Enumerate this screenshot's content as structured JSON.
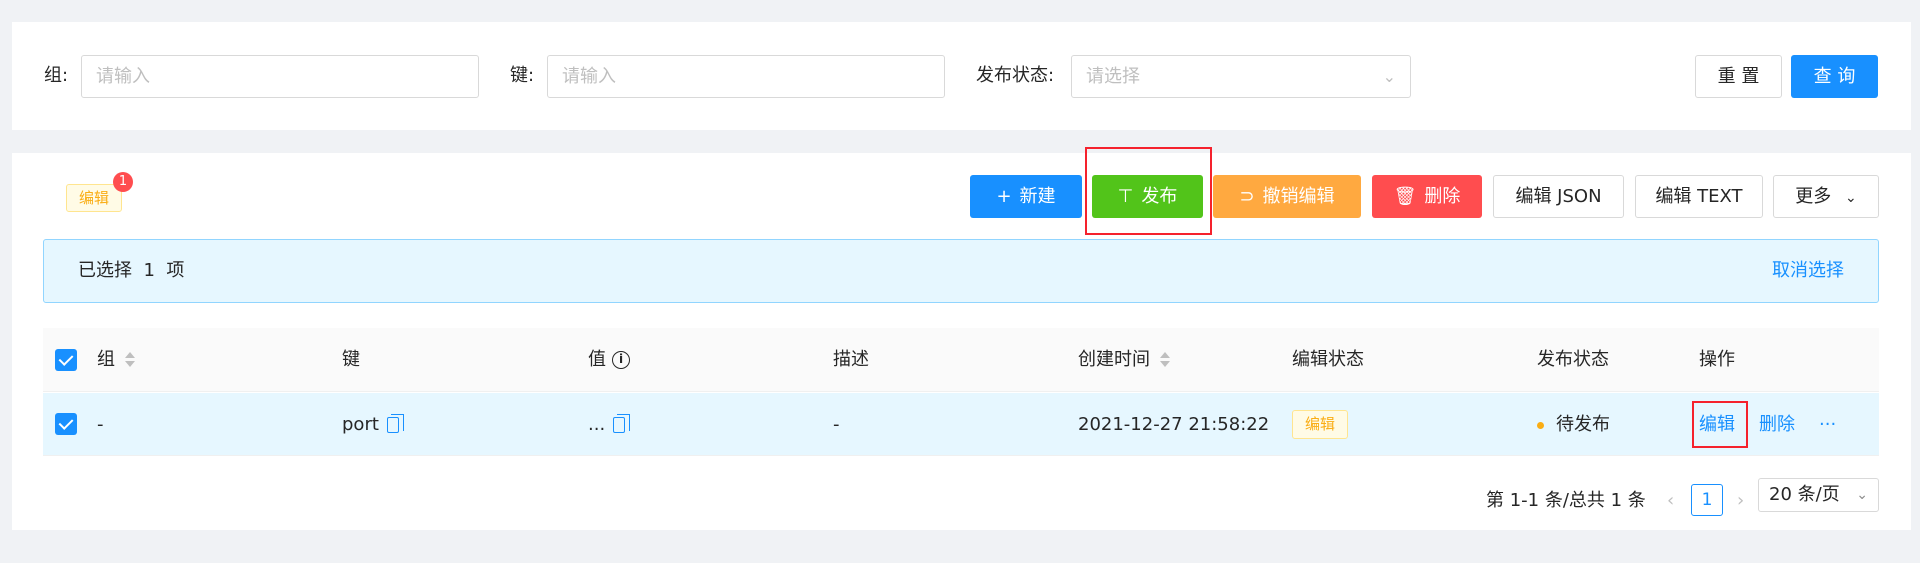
{
  "filters": {
    "group_label": "组:",
    "group_placeholder": "请输入",
    "key_label": "键:",
    "key_placeholder": "请输入",
    "status_label": "发布状态:",
    "status_placeholder": "请选择",
    "reset_label": "重 置",
    "query_label": "查 询"
  },
  "toolbar": {
    "tab_label": "编辑",
    "tab_badge": "1",
    "new_label": "新建",
    "publish_label": "发布",
    "revert_label": "撤销编辑",
    "delete_label": "删除",
    "edit_json_label": "编辑 JSON",
    "edit_text_label": "编辑 TEXT",
    "more_label": "更多"
  },
  "alert": {
    "selected_text": "已选择  1  项",
    "cancel_label": "取消选择"
  },
  "table": {
    "columns": {
      "group": "组",
      "key": "键",
      "value": "值",
      "desc": "描述",
      "created": "创建时间",
      "edit_status": "编辑状态",
      "publish_status": "发布状态",
      "actions": "操作"
    },
    "rows": [
      {
        "group": "-",
        "key": "port",
        "value": "...",
        "desc": "-",
        "created": "2021-12-27 21:58:22",
        "edit_status": "编辑",
        "publish_status": "待发布",
        "action_edit": "编辑",
        "action_delete": "删除",
        "action_more": "···"
      }
    ]
  },
  "pagination": {
    "total_text": "第 1-1 条/总共 1 条",
    "current_page": "1",
    "page_size": "20 条/页"
  },
  "colors": {
    "primary": "#1890ff",
    "publish": "#52c41a",
    "revert": "#ffa940",
    "danger": "#ff4d4f",
    "highlight": "#f5222d"
  }
}
